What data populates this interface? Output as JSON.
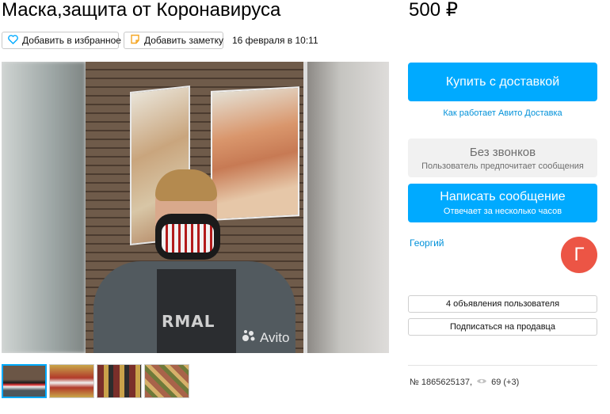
{
  "listing": {
    "title": "Маска,защита от Коронавируса",
    "price": "500 ₽",
    "favorite_label": "Добавить в избранное",
    "note_label": "Добавить заметку",
    "date": "16 февраля в 10:11"
  },
  "gallery": {
    "watermark": "Avito",
    "shirt_text": "RMAL",
    "thumbnails_count": 4
  },
  "actions": {
    "buy_label": "Купить с доставкой",
    "how_delivery_link": "Как работает Авито Доставка",
    "no_calls_title": "Без звонков",
    "no_calls_subtitle": "Пользователь предпочитает сообщения",
    "message_title": "Написать сообщение",
    "message_subtitle": "Отвечает за несколько часов"
  },
  "seller": {
    "name": "Георгий",
    "avatar_letter": "Г",
    "ads_button": "4 объявления пользователя",
    "subscribe_button": "Подписаться на продавца"
  },
  "stats": {
    "listing_number": "№ 1865625137,",
    "views": "69 (+3)"
  },
  "colors": {
    "accent": "#00aaff",
    "avatar": "#ec5545",
    "link": "#0091d9"
  }
}
